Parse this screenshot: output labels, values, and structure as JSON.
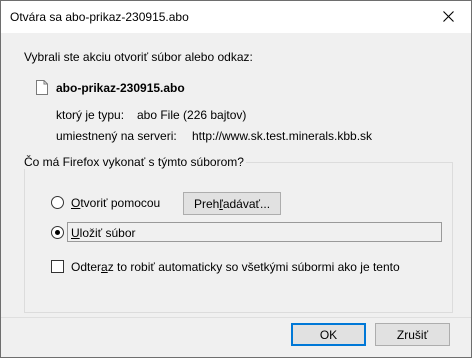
{
  "window": {
    "title": "Otvára sa abo-prikaz-230915.abo"
  },
  "intro": "Vybrali ste akciu otvoriť súbor alebo odkaz:",
  "file": {
    "name": "abo-prikaz-230915.abo",
    "type_label": "ktorý je typu:",
    "type_value": "abo File (226 bajtov)",
    "server_label": "umiestnený na serveri:",
    "server_value": "http://www.sk.test.minerals.kbb.sk"
  },
  "action_group": {
    "legend": "Čo má Firefox vykonať s týmto súborom?",
    "open_with": {
      "pre": "",
      "accel": "O",
      "post": "tvoriť pomocou",
      "selected": false
    },
    "browse_button": {
      "pre": "Preh",
      "accel": "ľ",
      "post": "adávať..."
    },
    "save_file": {
      "pre": "",
      "accel": "U",
      "post": "ložiť súbor",
      "selected": true
    },
    "auto": {
      "pre": "Odter",
      "accel": "a",
      "post": "z to robiť automaticky so všetkými súbormi ako je tento",
      "checked": false
    }
  },
  "buttons": {
    "ok": "OK",
    "cancel": "Zrušiť"
  },
  "colors": {
    "focus_border": "#0078d7",
    "title_bg": "#ffffff",
    "dialog_bg": "#f0f0f0"
  },
  "icons": {
    "close": "close-icon",
    "file": "file-icon"
  }
}
